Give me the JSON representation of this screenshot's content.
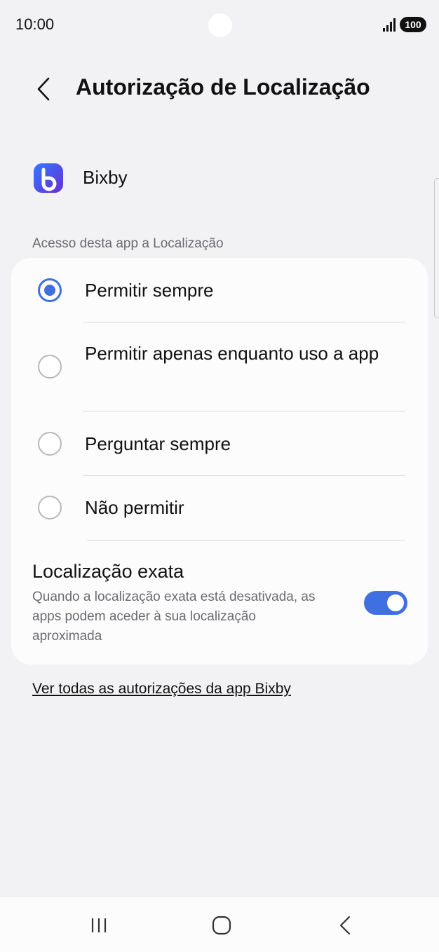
{
  "status_bar": {
    "time": "10:00",
    "battery": "100",
    "icons": [
      "signal-icon",
      "battery-icon"
    ]
  },
  "header": {
    "title": "Autorização de Localização",
    "back_icon": "chevron-left-icon"
  },
  "app": {
    "name": "Bixby",
    "icon": "bixby-app-icon"
  },
  "section": {
    "label": "Acesso desta app a Localização"
  },
  "options": [
    {
      "label": "Permitir sempre",
      "selected": true
    },
    {
      "label": "Permitir apenas enquanto uso a app",
      "selected": false
    },
    {
      "label": "Perguntar sempre",
      "selected": false
    },
    {
      "label": "Não permitir",
      "selected": false
    }
  ],
  "exact_location": {
    "title": "Localização exata",
    "description": "Quando a localização exata está desativada, as apps podem aceder à sua localização aproximada",
    "enabled": true
  },
  "link": {
    "label": "Ver todas as autorizações da app Bixby"
  },
  "nav_bar": {
    "icons": [
      "recents-icon",
      "home-icon",
      "back-icon"
    ]
  },
  "colors": {
    "accent": "#3f6fe0",
    "background": "#f2f2f4",
    "card": "#fcfcfd"
  }
}
